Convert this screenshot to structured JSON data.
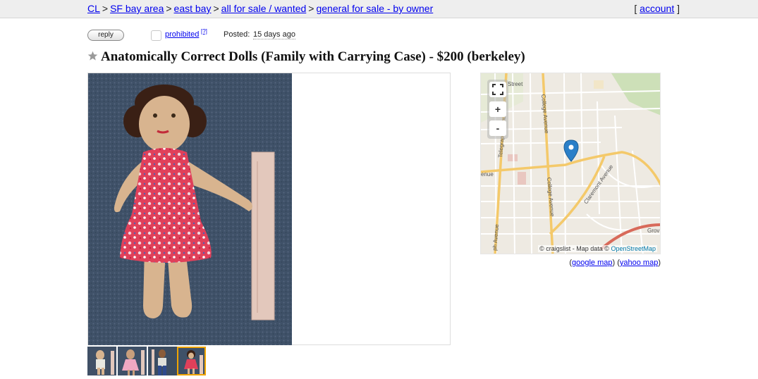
{
  "breadcrumb": {
    "items": [
      "CL",
      "SF bay area",
      "east bay",
      "all for sale / wanted",
      "general for sale - by owner"
    ],
    "separator": ">"
  },
  "account": {
    "open": "[",
    "label": "account",
    "close": "]"
  },
  "actions": {
    "reply_label": "reply",
    "flag_label": "prohibited",
    "flag_help": "[?]",
    "posted_label": "Posted:",
    "posted_time": "15 days ago"
  },
  "listing": {
    "title": "Anatomically Correct Dolls (Family with Carrying Case) - $200 (berkeley)"
  },
  "gallery": {
    "thumbnails": [
      "thumbnail-1",
      "thumbnail-2",
      "thumbnail-3",
      "thumbnail-4"
    ],
    "selected_index": 3
  },
  "map": {
    "zoom_in": "+",
    "zoom_out": "-",
    "street_labels": [
      "Telegraph Avenue",
      "College Avenue",
      "College Avenue",
      "Claremont Avenue",
      "Street",
      "enue",
      "ph Avenue",
      "Grov",
      "Ha"
    ],
    "attribution_prefix": "© craigslist - Map data ©",
    "attribution_link": "OpenStreetMap"
  },
  "map_links": {
    "google": "google map",
    "yahoo": "yahoo map",
    "open": "(",
    "close": ")"
  },
  "colors": {
    "link": "#0000ee",
    "topbar": "#eeeeee",
    "selected_thumb": "#f0a500",
    "map_pin": "#2a7fc8"
  }
}
